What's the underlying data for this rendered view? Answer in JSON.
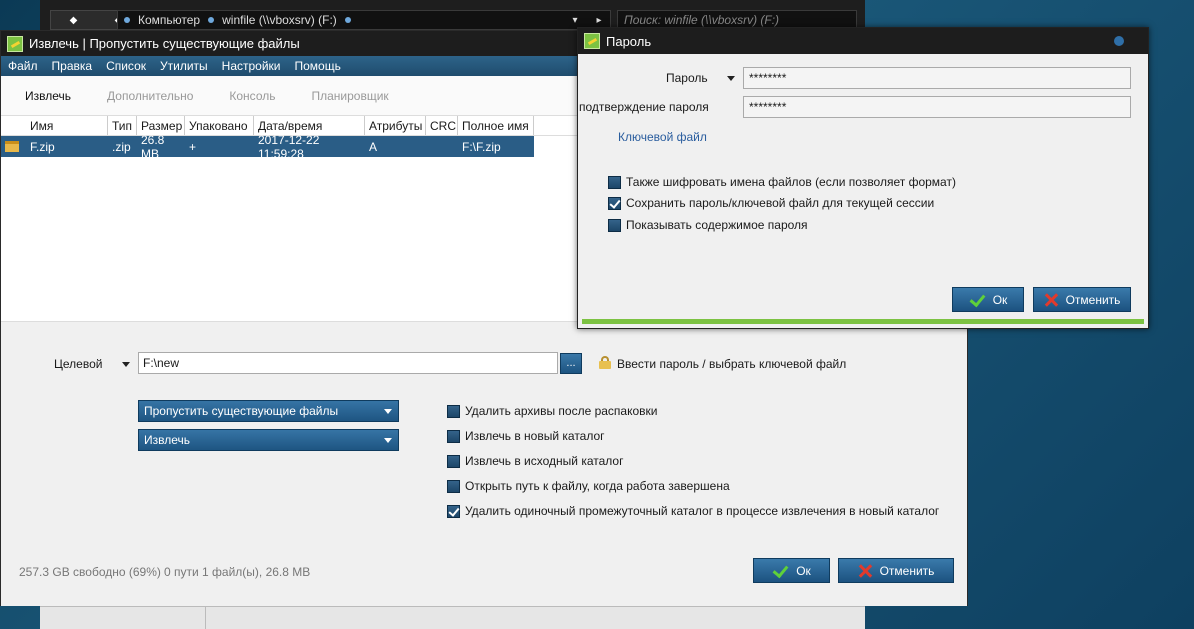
{
  "explorer": {
    "path_parts": [
      "Компьютер",
      "winfile (\\\\vboxsrv) (F:)"
    ],
    "search_placeholder": "Поиск: winfile (\\\\vboxsrv) (F:)"
  },
  "main_window": {
    "title": "Извлечь | Пропустить существующие файлы",
    "menu": [
      "Файл",
      "Правка",
      "Список",
      "Утилиты",
      "Настройки",
      "Помощь"
    ],
    "tabs": [
      "Извлечь",
      "Дополнительно",
      "Консоль",
      "Планировщик"
    ],
    "columns": [
      "Имя",
      "Тип",
      "Размер",
      "Упаковано",
      "Дата/время",
      "Атрибуты",
      "CRC",
      "Полное имя"
    ],
    "files": [
      {
        "name": "F.zip",
        "type": ".zip",
        "size": "26.8 MB",
        "packed": "+",
        "datetime": "2017-12-22 11:59:28",
        "attributes": "A",
        "crc": "",
        "fullname": "F:\\F.zip"
      }
    ],
    "target_label": "Целевой",
    "target_value": "F:\\new",
    "browse_label": "...",
    "password_link": "Ввести пароль / выбрать ключевой файл",
    "combo_mode": "Пропустить существующие файлы",
    "combo_action": "Извлечь",
    "options": [
      {
        "label": "Удалить архивы после распаковки",
        "checked": false
      },
      {
        "label": "Извлечь в новый каталог",
        "checked": false
      },
      {
        "label": "Извлечь в исходный каталог",
        "checked": false
      },
      {
        "label": "Открыть путь к файлу, когда работа завершена",
        "checked": false
      },
      {
        "label": "Удалить одиночный промежуточный каталог в процессе извлечения в новый каталог",
        "checked": true
      }
    ],
    "status_free": "257.3 GB свободно (69%)",
    "status_info": "0 пути 1 файл(ы), 26.8 MB",
    "ok_label": "Ок",
    "cancel_label": "Отменить"
  },
  "password_dialog": {
    "title": "Пароль",
    "password_label": "Пароль",
    "password_value": "********",
    "confirm_label": "подтверждение пароля",
    "confirm_value": "********",
    "keyfile_link": "Ключевой файл",
    "options": [
      {
        "label": "Также шифровать имена файлов (если позволяет формат)",
        "checked": false
      },
      {
        "label": "Сохранить пароль/ключевой файл для текущей сессии",
        "checked": true
      },
      {
        "label": "Показывать содержимое пароля",
        "checked": false
      }
    ],
    "ok_label": "Ок",
    "cancel_label": "Отменить"
  }
}
